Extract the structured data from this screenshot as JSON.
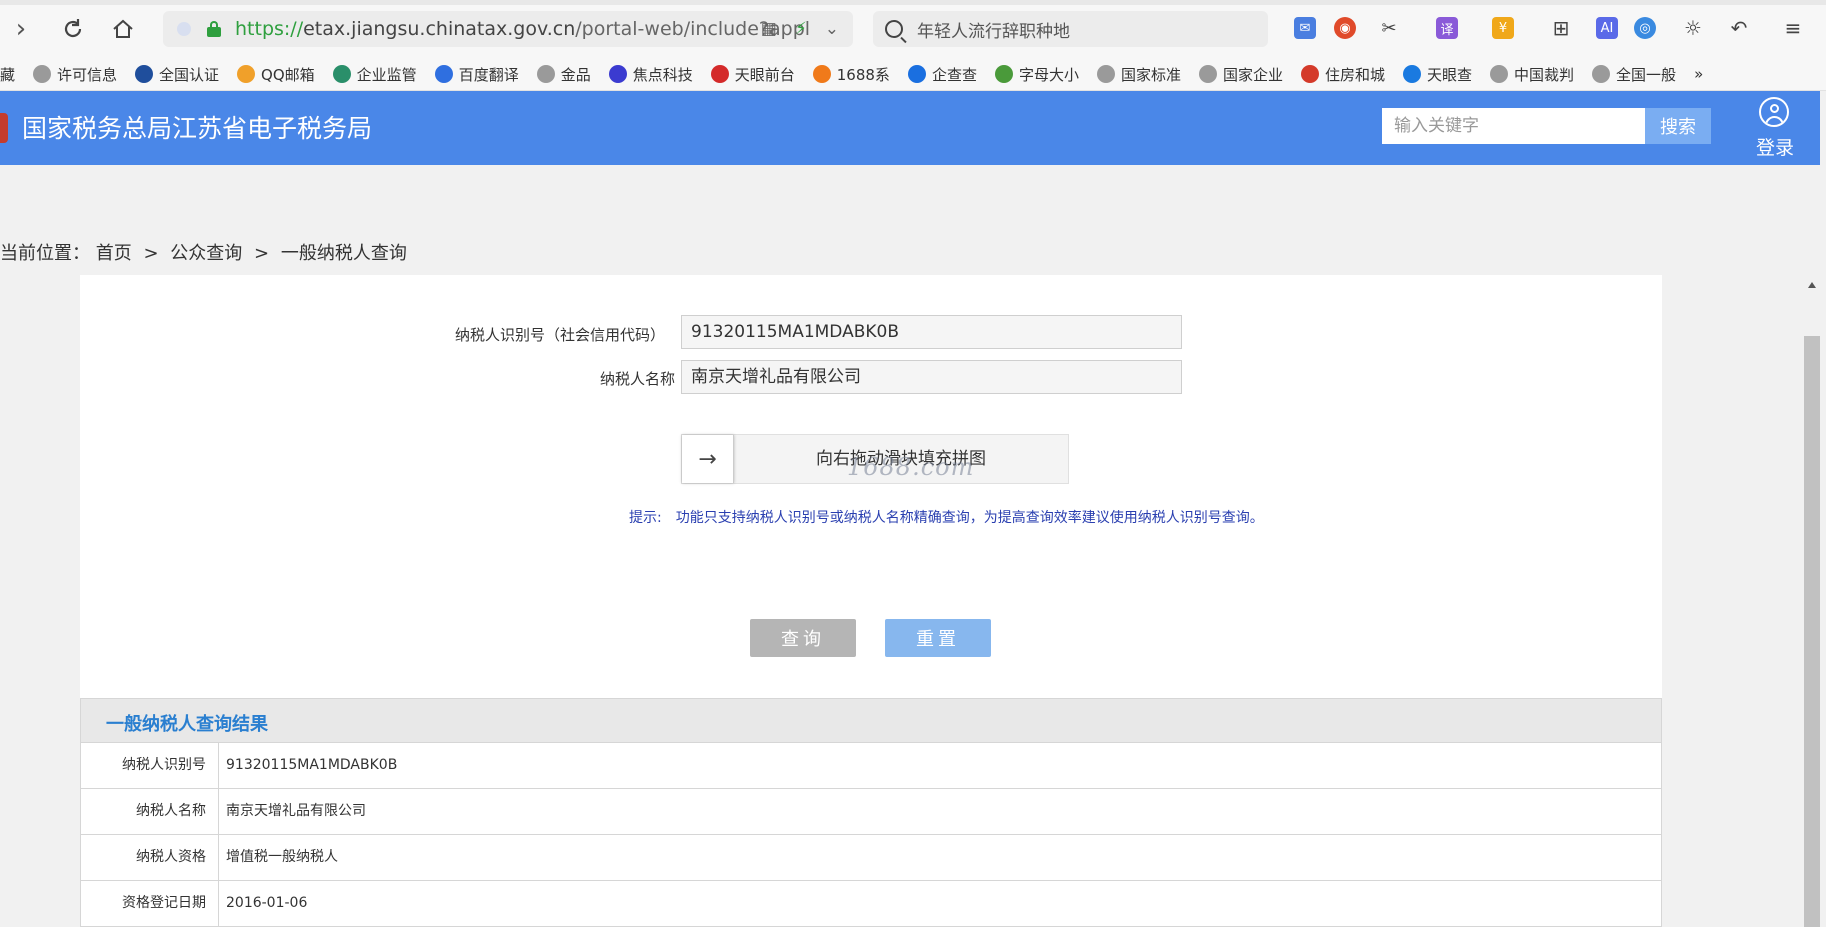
{
  "browser": {
    "url_https": "https://",
    "url_host": "etax.jiangsu.chinatax.gov.cn",
    "url_path": "/portal-web/include?appl",
    "search_text": "年轻人流行辞职种地"
  },
  "bookmarks": [
    {
      "label": "藏",
      "color": "#ffffff"
    },
    {
      "label": "许可信息",
      "color": "#9a9a9a"
    },
    {
      "label": "全国认证",
      "color": "#1f4e9c"
    },
    {
      "label": "QQ邮箱",
      "color": "#f0a02a"
    },
    {
      "label": "企业监管",
      "color": "#2a8f6a"
    },
    {
      "label": "百度翻译",
      "color": "#2f6fe0"
    },
    {
      "label": "金品",
      "color": "#9a9a9a"
    },
    {
      "label": "焦点科技",
      "color": "#3b3bd0"
    },
    {
      "label": "天眼前台",
      "color": "#d42a2a"
    },
    {
      "label": "1688系",
      "color": "#f07a1a"
    },
    {
      "label": "企查查",
      "color": "#1a6fe0"
    },
    {
      "label": "字母大小",
      "color": "#4a9a3a"
    },
    {
      "label": "国家标准",
      "color": "#9a9a9a"
    },
    {
      "label": "国家企业",
      "color": "#9a9a9a"
    },
    {
      "label": "住房和城",
      "color": "#d43a2a"
    },
    {
      "label": "天眼查",
      "color": "#1a7ae0"
    },
    {
      "label": "中国裁判",
      "color": "#9a9a9a"
    },
    {
      "label": "全国一般",
      "color": "#9a9a9a"
    },
    {
      "label": "»",
      "color": "#ffffff"
    }
  ],
  "header": {
    "site_title": "国家税务总局江苏省电子税务局",
    "search_placeholder": "输入关键字",
    "search_button": "搜索",
    "login_label": "登录"
  },
  "breadcrumb": {
    "prefix": "当前位置：",
    "items": [
      "首页",
      "公众查询",
      "一般纳税人查询"
    ],
    "separator": ">"
  },
  "form": {
    "taxpayer_id_label": "纳税人识别号（社会信用代码）",
    "taxpayer_id_value": "91320115MA1MDABK0B",
    "taxpayer_name_label": "纳税人名称",
    "taxpayer_name_value": "南京天增礼品有限公司",
    "slider_text": "向右拖动滑块填充拼图",
    "slider_arrow": "→",
    "hint_label": "提示:",
    "hint_text": "功能只支持纳税人识别号或纳税人名称精确查询，为提高查询效率建议使用纳税人识别号查询。",
    "query_button": "查询",
    "reset_button": "重置"
  },
  "watermark": "1688.com",
  "results": {
    "title": "一般纳税人查询结果",
    "rows": [
      {
        "key": "纳税人识别号",
        "value": "91320115MA1MDABK0B"
      },
      {
        "key": "纳税人名称",
        "value": "南京天增礼品有限公司"
      },
      {
        "key": "纳税人资格",
        "value": "增值税一般纳税人"
      },
      {
        "key": "资格登记日期",
        "value": "2016-01-06"
      }
    ]
  },
  "colors": {
    "header_bg": "#4a87e8",
    "results_title": "#2a7fd0",
    "hint_text": "#2a3fb0"
  }
}
